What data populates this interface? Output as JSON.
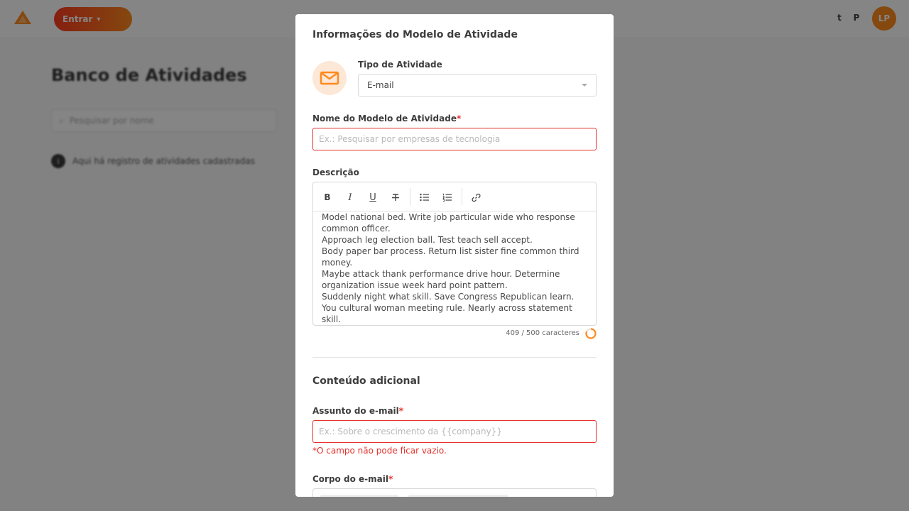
{
  "background": {
    "topbar": {
      "button_label": "Entrar",
      "icon_a": "t",
      "icon_b": "P",
      "avatar_initials": "LP"
    },
    "page_title": "Banco de Atividades",
    "search_placeholder": "Pesquisar por nome",
    "info_text": "Aqui há registro de atividades cadastradas"
  },
  "modal": {
    "title": "Informações do Modelo de Atividade",
    "activity_type": {
      "label": "Tipo de Atividade",
      "value": "E-mail",
      "icon": "mail-icon"
    },
    "template_name": {
      "label": "Nome do Modelo de Atividade",
      "required_mark": "*",
      "placeholder": "Ex.: Pesquisar por empresas de tecnologia"
    },
    "description": {
      "label": "Descrição",
      "toolbar": [
        "bold-icon",
        "italic-icon",
        "underline-icon",
        "strikethrough-icon",
        "bullet-list-icon",
        "numbered-list-icon",
        "link-icon"
      ],
      "lines": [
        "Model national bed. Write job particular wide who response common officer.",
        "Approach leg election ball. Test teach sell accept.",
        "Body paper bar process. Return list sister fine common third money.",
        "Maybe attack thank performance drive hour. Determine organization issue week hard point pattern.",
        "Suddenly night what skill. Save Congress Republican learn.",
        "You cultural woman meeting rule. Nearly across statement skill."
      ],
      "counter_text": "409 / 500 caracteres",
      "counter_fraction": 0.818
    },
    "additional_content": {
      "title": "Conteúdo adicional",
      "subject": {
        "label": "Assunto do e-mail",
        "required_mark": "*",
        "placeholder": "Ex.: Sobre o crescimento da {{company}}",
        "error": "*O campo não pode ficar vazio."
      },
      "body": {
        "label": "Corpo do e-mail",
        "required_mark": "*"
      }
    }
  },
  "colors": {
    "accent": "#ff8a1e",
    "error": "#e5322d",
    "overlay": "rgba(0,0,0,0.48)"
  }
}
